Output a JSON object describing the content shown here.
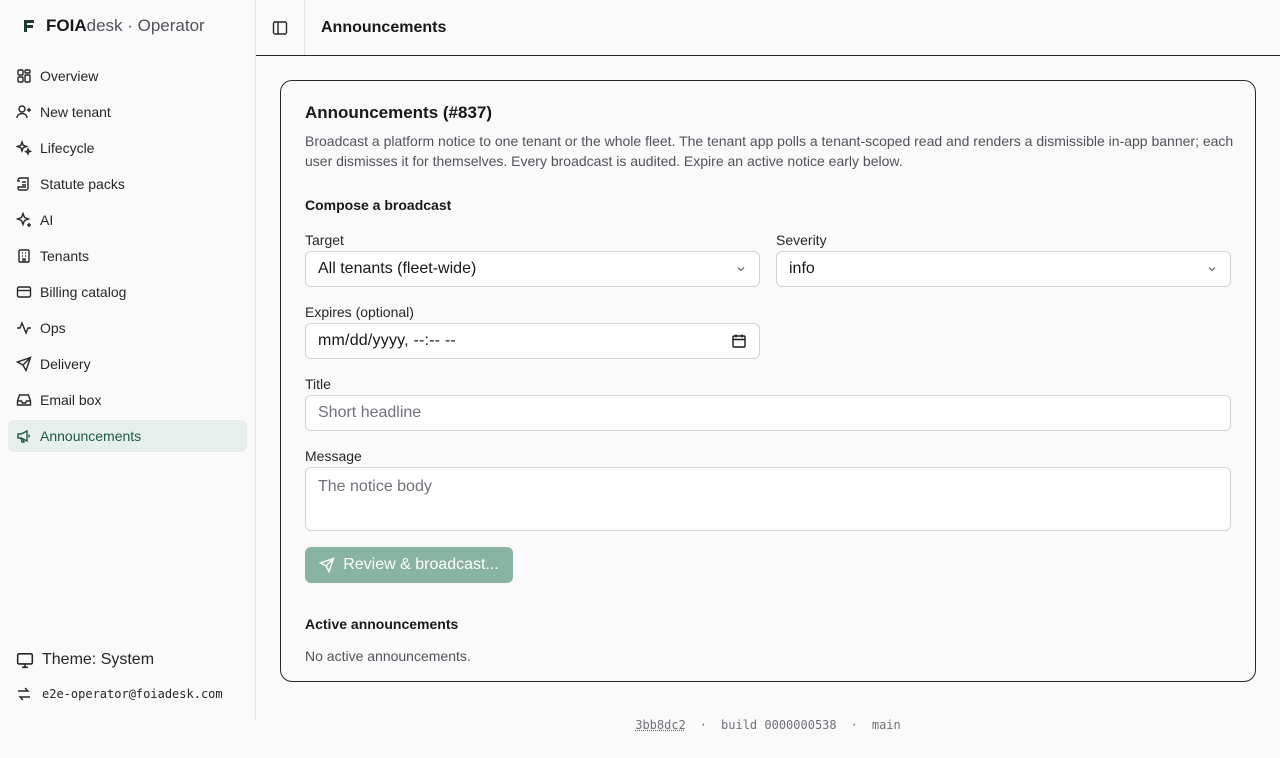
{
  "brand": {
    "bold": "FOIA",
    "rest": "desk · Operator"
  },
  "nav": {
    "items": [
      {
        "label": "Overview",
        "icon": "grid-icon"
      },
      {
        "label": "New tenant",
        "icon": "user-plus-icon"
      },
      {
        "label": "Lifecycle",
        "icon": "sparkles-icon"
      },
      {
        "label": "Statute packs",
        "icon": "scroll-icon"
      },
      {
        "label": "AI",
        "icon": "sparkle-icon"
      },
      {
        "label": "Tenants",
        "icon": "building-icon"
      },
      {
        "label": "Billing catalog",
        "icon": "credit-card-icon"
      },
      {
        "label": "Ops",
        "icon": "activity-icon"
      },
      {
        "label": "Delivery",
        "icon": "send-icon"
      },
      {
        "label": "Email box",
        "icon": "inbox-icon"
      },
      {
        "label": "Announcements",
        "icon": "megaphone-icon",
        "active": true
      }
    ]
  },
  "sidebar_footer": {
    "theme_label": "Theme: System",
    "user_email": "e2e-operator@foiadesk.com"
  },
  "topbar": {
    "title": "Announcements"
  },
  "card": {
    "title": "Announcements (#837)",
    "description": "Broadcast a platform notice to one tenant or the whole fleet. The tenant app polls a tenant-scoped read and renders a dismissible in-app banner; each user dismisses it for themselves. Every broadcast is audited. Expire an active notice early below.",
    "compose_title": "Compose a broadcast",
    "target": {
      "label": "Target",
      "value": "All tenants (fleet-wide)"
    },
    "severity": {
      "label": "Severity",
      "value": "info"
    },
    "expires": {
      "label": "Expires (optional)",
      "value": "mm/dd/yyyy, --:-- --"
    },
    "title_field": {
      "label": "Title",
      "placeholder": "Short headline"
    },
    "message_field": {
      "label": "Message",
      "placeholder": "The notice body"
    },
    "broadcast_button": "Review & broadcast...",
    "active_title": "Active announcements",
    "active_empty": "No active announcements."
  },
  "footer": {
    "commit": "3bb8dc2",
    "sep": "·",
    "build": "build 0000000538",
    "branch": "main"
  },
  "colors": {
    "accent": "#1f5a44",
    "accent_bg": "#e6efeb",
    "button_disabled": "#89b4a2"
  }
}
